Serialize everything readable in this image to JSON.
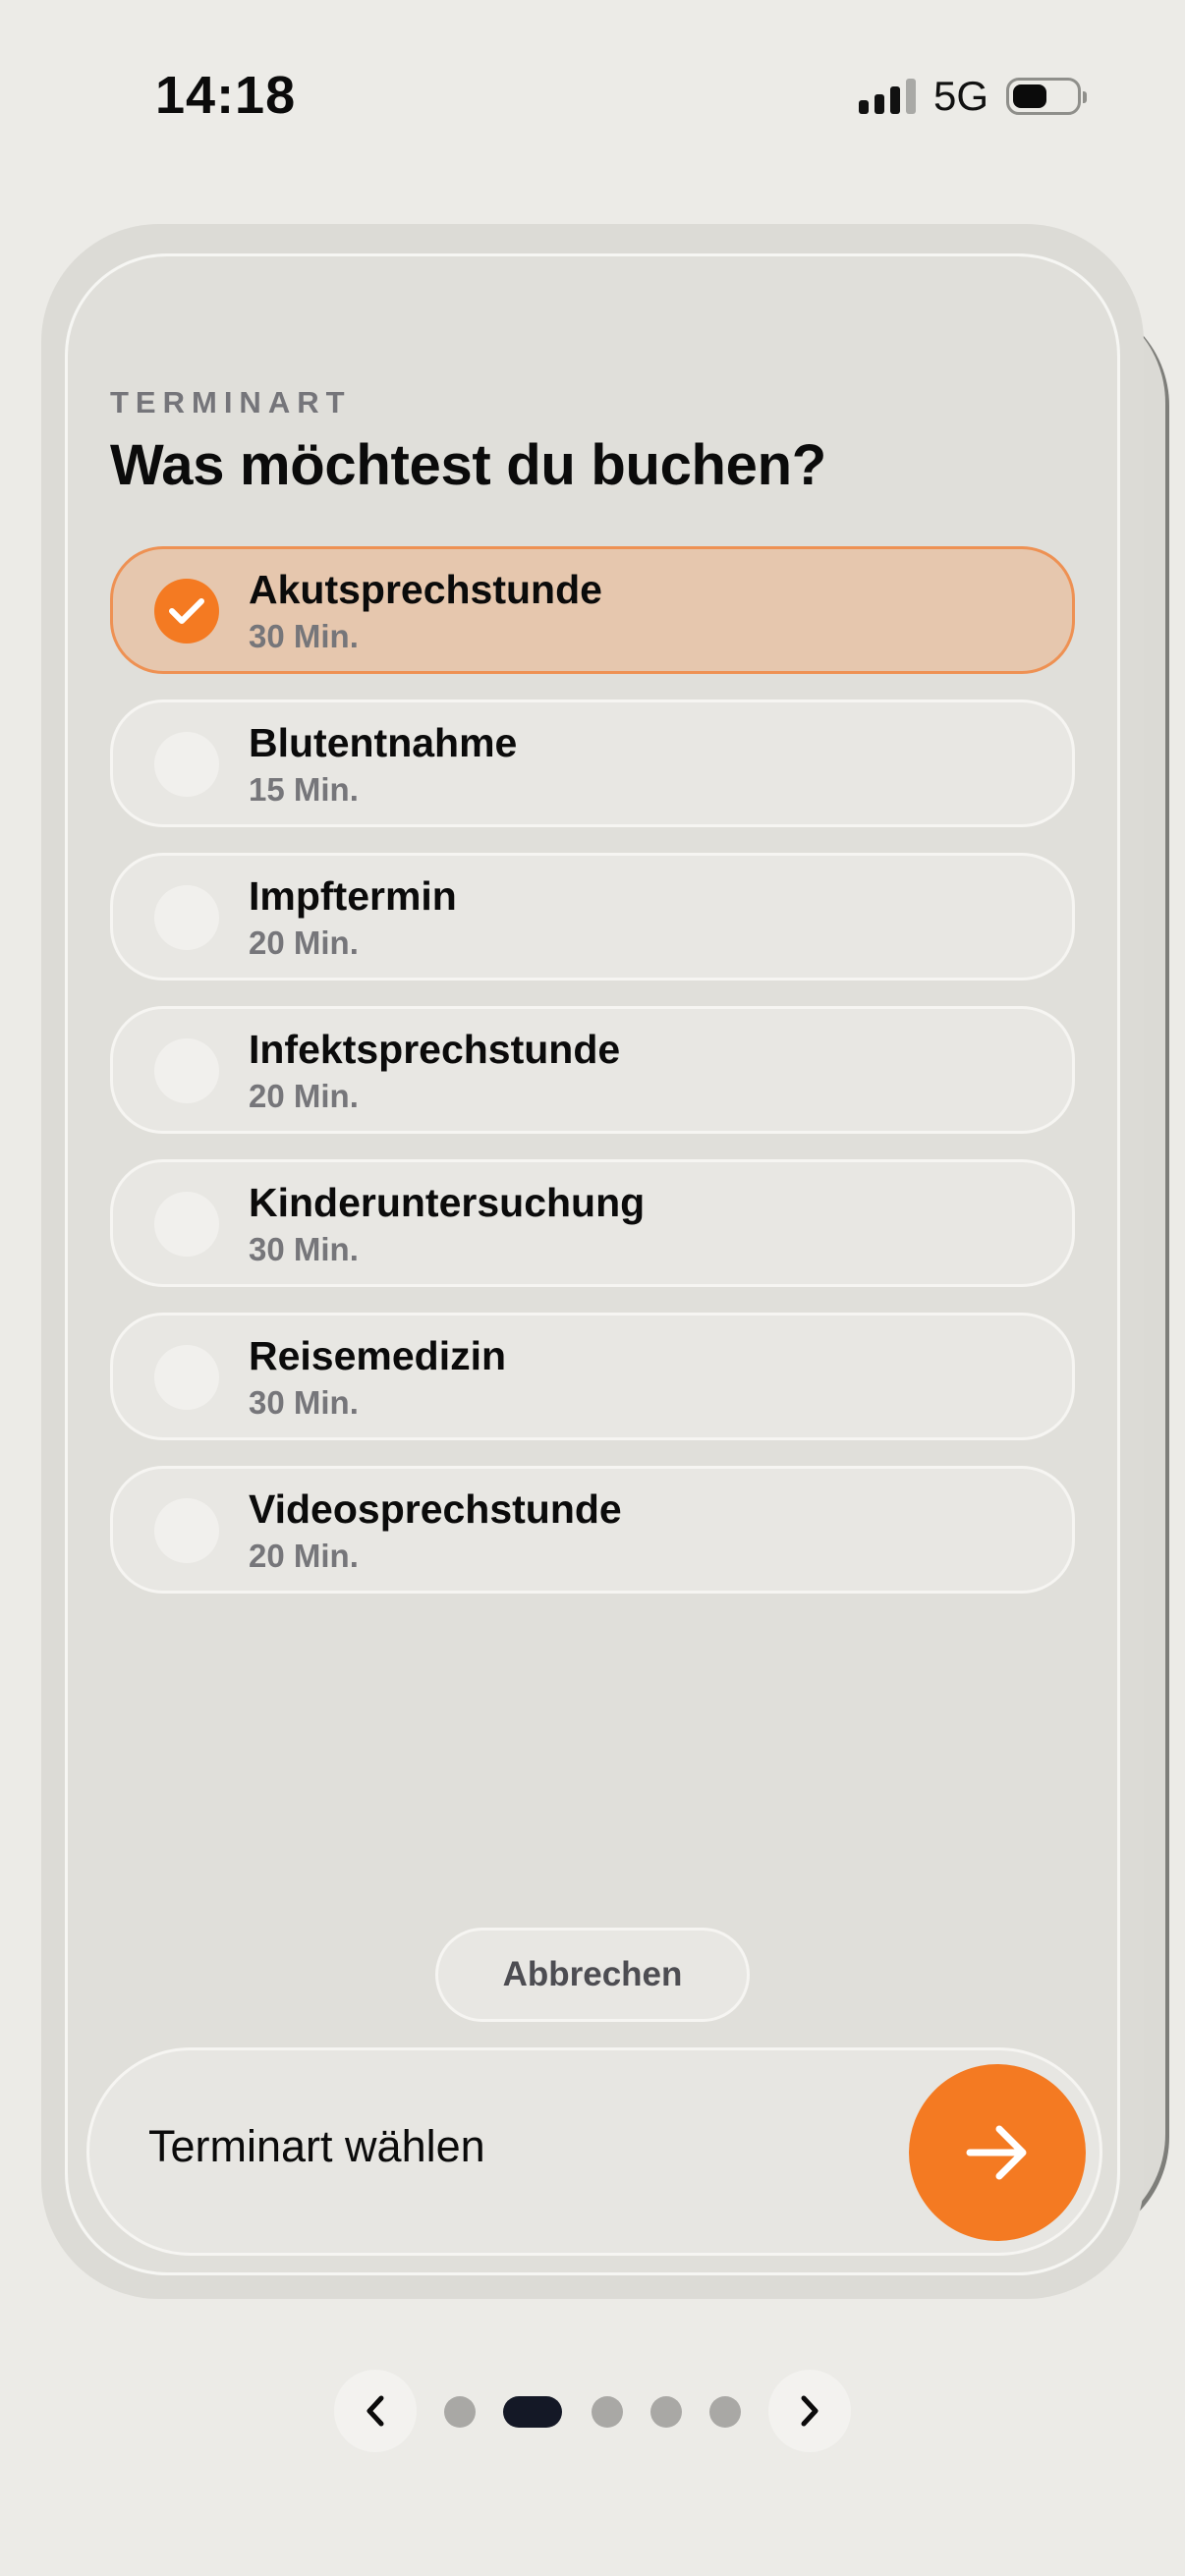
{
  "status_bar": {
    "time": "14:18",
    "network": "5G",
    "battery_level": 0.55
  },
  "header": {
    "eyebrow": "TERMINART",
    "title": "Was möchtest du buchen?"
  },
  "options": [
    {
      "title": "Akutsprechstunde",
      "duration": "30 Min.",
      "selected": true
    },
    {
      "title": "Blutentnahme",
      "duration": "15 Min.",
      "selected": false
    },
    {
      "title": "Impftermin",
      "duration": "20 Min.",
      "selected": false
    },
    {
      "title": "Infektsprechstunde",
      "duration": "20 Min.",
      "selected": false
    },
    {
      "title": "Kinderuntersuchung",
      "duration": "30 Min.",
      "selected": false
    },
    {
      "title": "Reisemedizin",
      "duration": "30 Min.",
      "selected": false
    },
    {
      "title": "Videosprechstunde",
      "duration": "20 Min.",
      "selected": false
    }
  ],
  "cancel_label": "Abbrechen",
  "action": {
    "label": "Terminart wählen",
    "icon": "arrow-right-icon"
  },
  "pager": {
    "count": 5,
    "active_index": 1,
    "prev_icon": "chevron-left-icon",
    "next_icon": "chevron-right-icon"
  },
  "colors": {
    "accent": "#F47A22",
    "selected_bg": "#E6C7AE",
    "selected_border": "#EE9153",
    "page_bg": "#ECEBE7",
    "pager_active": "#141826"
  }
}
